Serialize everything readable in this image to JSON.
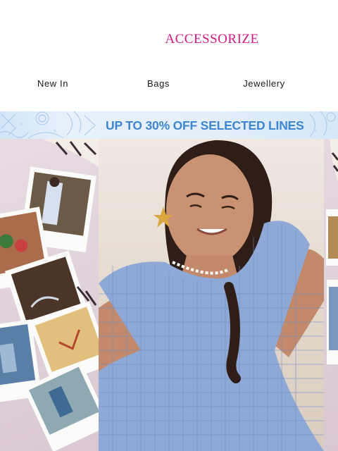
{
  "brand": {
    "name": "ACCESSORIZE",
    "color": "#d21a82"
  },
  "nav": {
    "items": [
      {
        "label": "New In"
      },
      {
        "label": "Bags"
      },
      {
        "label": "Jewellery"
      }
    ]
  },
  "promo": {
    "text": "UP TO 30% OFF SELECTED LINES",
    "color": "#3f86d0"
  },
  "hero": {
    "subject": "woman in blue gingham dress taking a selfie, polaroid photos on pink background"
  }
}
